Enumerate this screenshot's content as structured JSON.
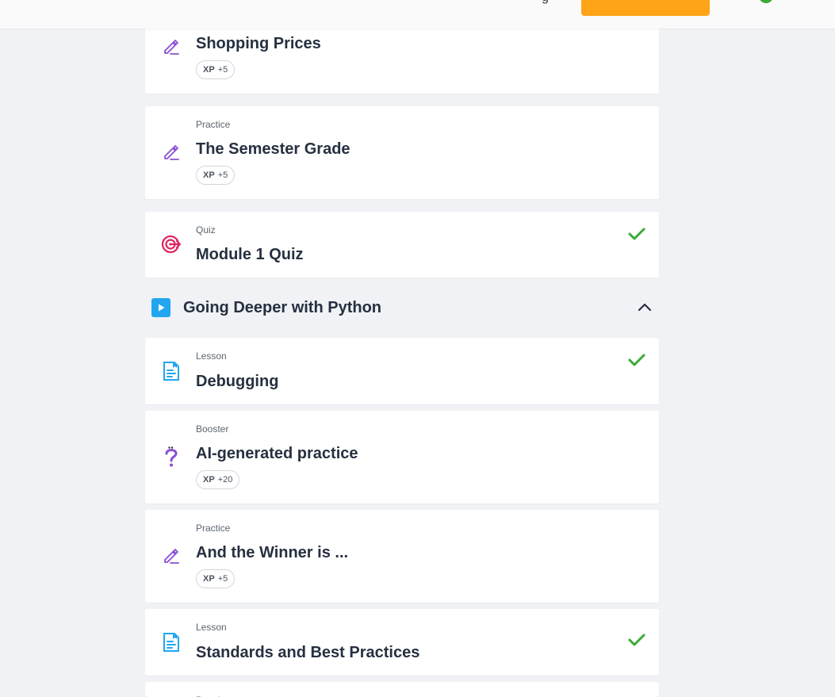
{
  "header": {
    "nav_fragment": "g"
  },
  "colors": {
    "accent": "#ffa416",
    "practice_icon": "#8a4fd3",
    "quiz_icon": "#e0245e",
    "lesson_icon": "#22a6f0",
    "check": "#3aaa35"
  },
  "items_top": [
    {
      "type": "",
      "title": "Shopping Prices",
      "xp_label": "XP",
      "xp_value": "+5",
      "icon": "pencil-icon"
    },
    {
      "type": "Practice",
      "title": "The Semester Grade",
      "xp_label": "XP",
      "xp_value": "+5",
      "icon": "pencil-icon"
    },
    {
      "type": "Quiz",
      "title": "Module 1 Quiz",
      "icon": "target-icon",
      "completed": true
    }
  ],
  "section": {
    "title": "Going Deeper with Python",
    "icon": "play-icon",
    "expanded": true
  },
  "items_section": [
    {
      "type": "Lesson",
      "title": "Debugging",
      "icon": "document-icon",
      "completed": true
    },
    {
      "type": "Booster",
      "title": "AI-generated practice",
      "xp_label": "XP",
      "xp_value": "+20",
      "icon": "question-icon"
    },
    {
      "type": "Practice",
      "title": "And the Winner is ...",
      "xp_label": "XP",
      "xp_value": "+5",
      "icon": "pencil-icon"
    },
    {
      "type": "Lesson",
      "title": "Standards and Best Practices",
      "icon": "document-icon",
      "completed": true
    },
    {
      "type": "Practice",
      "title": "",
      "icon": "pencil-icon"
    }
  ]
}
